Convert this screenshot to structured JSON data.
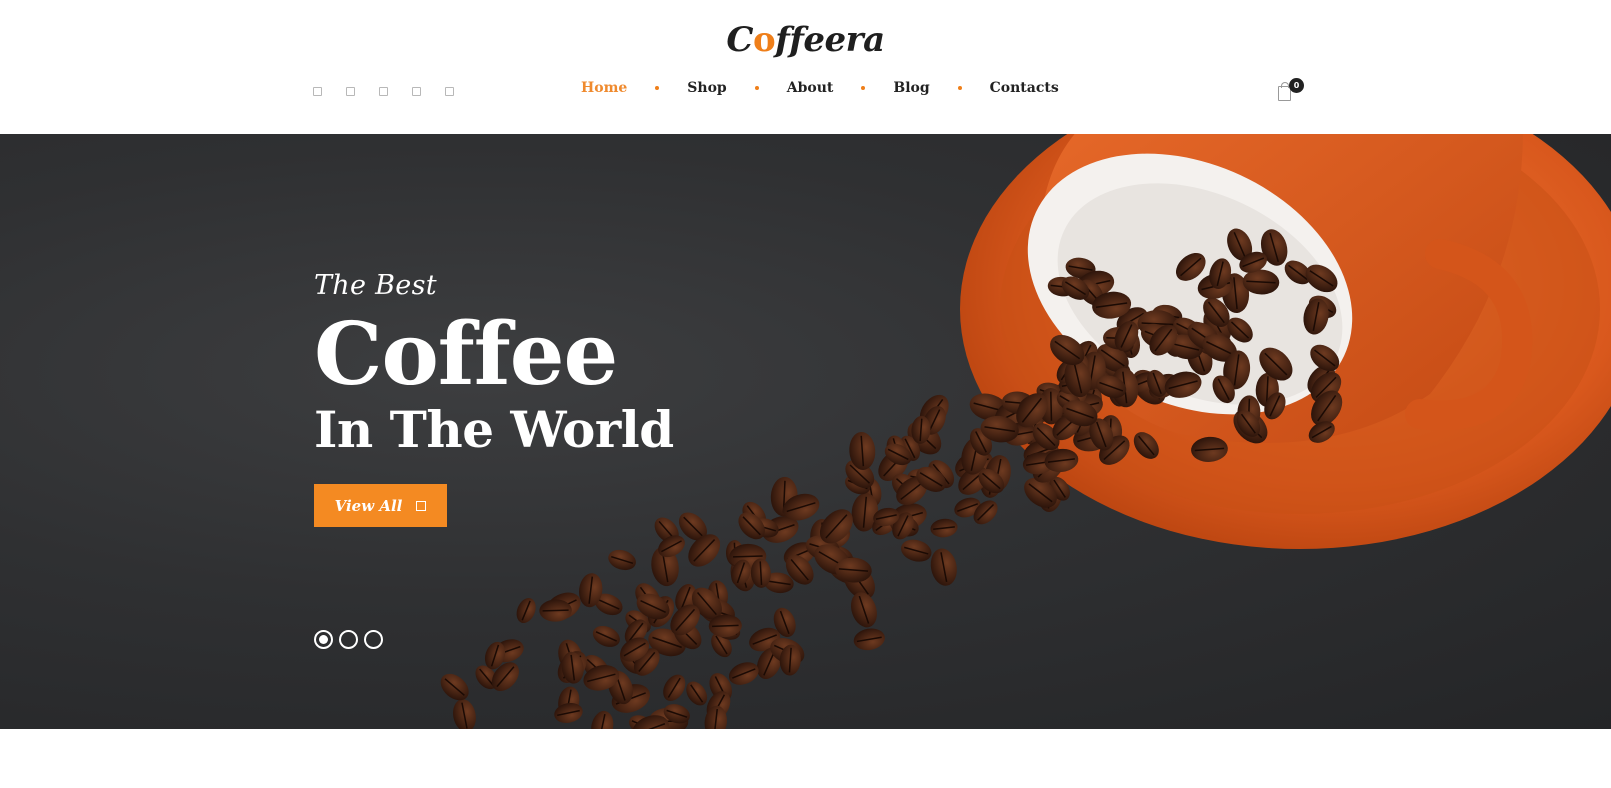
{
  "header": {
    "logo_pre": "C",
    "logo_bean": "o",
    "logo_post": "ffeera",
    "social_icons": [
      "social-icon-1",
      "social-icon-2",
      "social-icon-3",
      "social-icon-4",
      "social-icon-5"
    ],
    "nav": {
      "home": "Home",
      "shop": "Shop",
      "about": "About",
      "blog": "Blog",
      "contacts": "Contacts"
    },
    "cart_count": "0"
  },
  "hero": {
    "tagline": "The Best",
    "headline": "Coffee",
    "subhead": "In The World",
    "cta_label": "View All",
    "slides_total": 3,
    "slide_active": 1
  },
  "colors": {
    "accent": "#f48a22",
    "dark_bg": "#2f3032",
    "cup": "#d9581d"
  }
}
